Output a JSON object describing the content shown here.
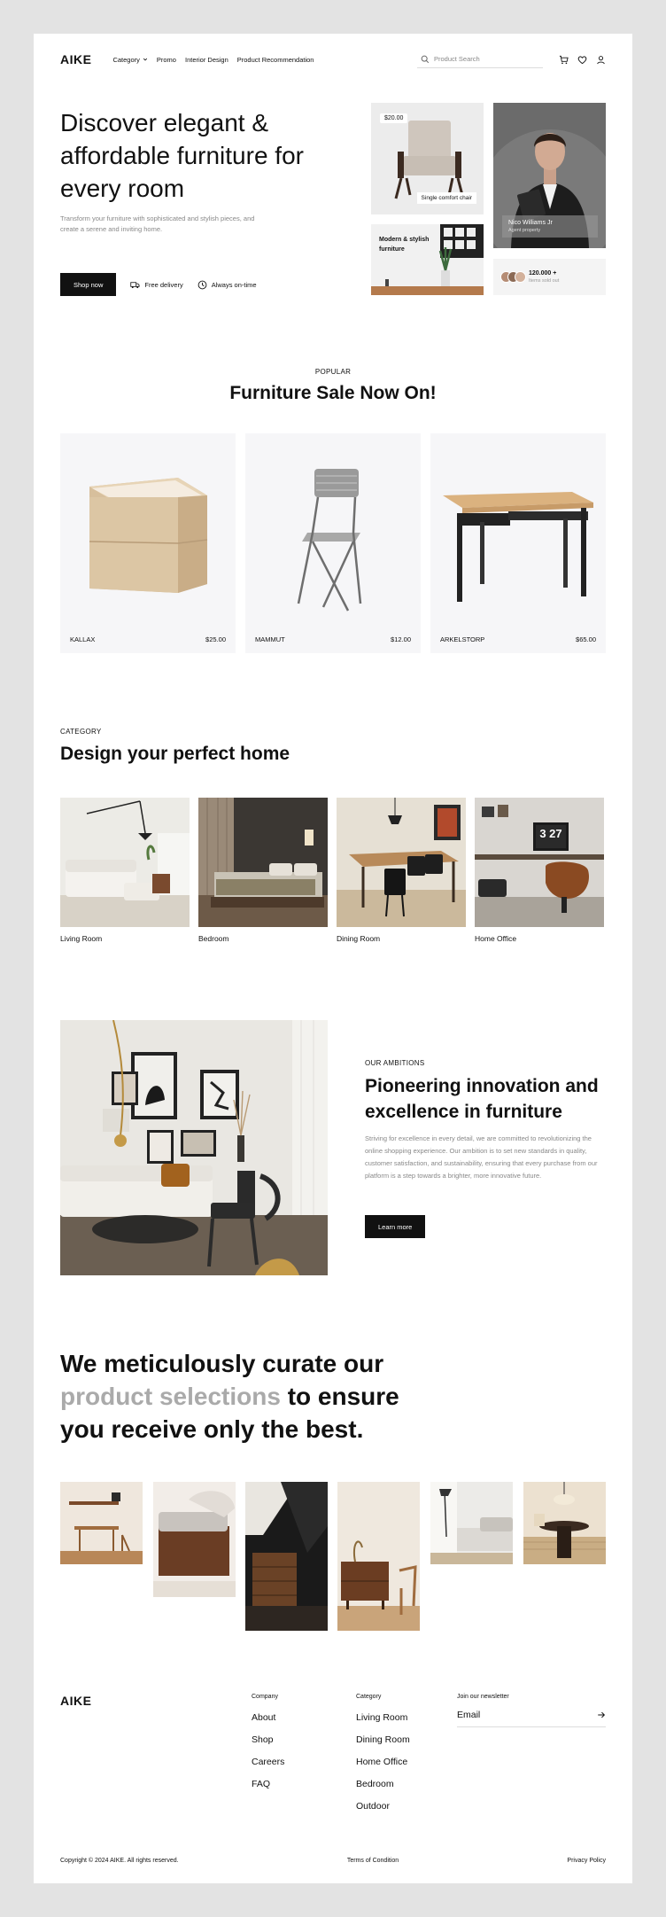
{
  "nav": {
    "logo": "AIKE",
    "menu": [
      "Category",
      "Promo",
      "Interior Design",
      "Product Recommendation"
    ],
    "search_placeholder": "Product Search",
    "icons": [
      "cart-icon",
      "heart-icon",
      "user-icon"
    ]
  },
  "hero": {
    "title": "Discover elegant & affordable furniture for every room",
    "subtitle": "Transform your furniture with sophisticated and stylish pieces, and create a serene and inviting home.",
    "cta": "Shop now",
    "feature_1": "Free delivery",
    "feature_2": "Always on-time",
    "card_price": "$20.00",
    "card_chair_label": "Single comfort chair",
    "card_modern_label": "Modern & stylish furniture",
    "person_name": "Nico Williams Jr",
    "person_role": "Agent property",
    "stats_number": "120.000 +",
    "stats_label": "Items sold out"
  },
  "popular": {
    "eyebrow": "POPULAR",
    "title": "Furniture Sale Now On!",
    "products": [
      {
        "name": "KALLAX",
        "price": "$25.00"
      },
      {
        "name": "MAMMUT",
        "price": "$12.00"
      },
      {
        "name": "ARKELSTORP",
        "price": "$65.00"
      }
    ]
  },
  "category": {
    "eyebrow": "CATEGORY",
    "title": "Design your perfect home",
    "items": [
      "Living Room",
      "Bedroom",
      "Dining Room",
      "Home Office"
    ],
    "clock_digits": "3 27"
  },
  "ambitions": {
    "eyebrow": "OUR AMBITIONS",
    "title": "Pioneering innovation and excellence in furniture",
    "text": "Striving for excellence in every detail, we are committed to revolutionizing the online shopping experience. Our ambition is to set new standards in quality, customer satisfaction, and sustainability, ensuring that every purchase from our platform is a step towards a brighter, more innovative future.",
    "cta": "Learn more"
  },
  "curate": {
    "part1": "We meticulously curate our ",
    "highlight": "product selections",
    "part2": " to ensure you receive only the best."
  },
  "footer": {
    "logo": "AIKE",
    "company_heading": "Company",
    "company_links": [
      "About",
      "Shop",
      "Careers",
      "FAQ"
    ],
    "category_heading": "Category",
    "category_links": [
      "Living Room",
      "Dining Room",
      "Home Office",
      "Bedroom",
      "Outdoor"
    ],
    "newsletter_heading": "Join our newsletter",
    "newsletter_placeholder": "Email",
    "copyright": "Copyright © 2024 AIKE. All rights reserved.",
    "terms": "Terms of Condition",
    "privacy": "Privacy Policy"
  },
  "colors": {
    "background": "#e3e3e3",
    "accent_dark": "#111111",
    "muted_text": "#888888",
    "card_bg": "#f6f6f8"
  }
}
